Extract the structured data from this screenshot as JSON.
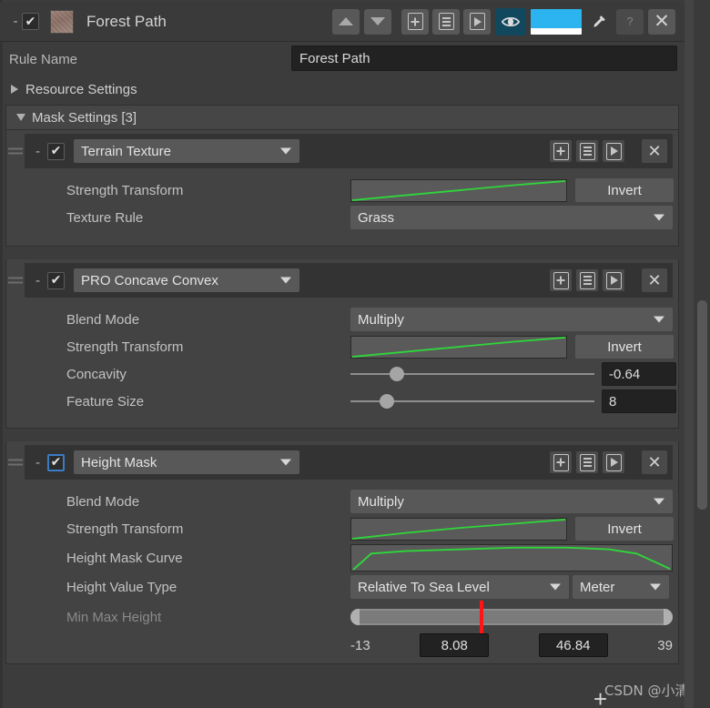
{
  "header": {
    "foldout_dash": "-",
    "enabled": true,
    "check_glyph": "✔",
    "title": "Forest Path",
    "thumbnail_name": "terrain-texture-thumbnail",
    "move_up_icon": "triangle-up-icon",
    "move_down_icon": "triangle-down-icon",
    "add_icon": "add-box-icon",
    "list_icon": "list-box-icon",
    "play_icon": "play-box-icon",
    "visibility_icon": "eye-icon",
    "color_swatch": "#2BB4EF",
    "color_swatch_underline": "#FFFFFF",
    "eyedropper_icon": "eyedropper-icon",
    "help_label": "?",
    "close_label": "✕"
  },
  "rule_name": {
    "label": "Rule Name",
    "value": "Forest Path"
  },
  "resource_settings": {
    "label": "Resource Settings",
    "expanded": false
  },
  "mask_settings": {
    "label": "Mask Settings [3]",
    "expanded": true,
    "count": 3
  },
  "masks": [
    {
      "foldout_dash": "-",
      "enabled": true,
      "check_glyph": "✔",
      "selected": false,
      "type": "Terrain Texture",
      "head_buttons": [
        "add-box-icon",
        "list-box-icon",
        "play-box-icon"
      ],
      "close_label": "✕",
      "rows": [
        {
          "kind": "curve",
          "label": "Strength Transform",
          "button": "Invert",
          "curve": "linear-ramp"
        },
        {
          "kind": "dropdown_wide",
          "label": "Texture Rule",
          "value": "Grass"
        }
      ]
    },
    {
      "foldout_dash": "-",
      "enabled": true,
      "check_glyph": "✔",
      "selected": false,
      "type": "PRO Concave Convex",
      "head_buttons": [
        "add-box-icon",
        "list-box-icon",
        "play-box-icon"
      ],
      "close_label": "✕",
      "rows": [
        {
          "kind": "dropdown_wide",
          "label": "Blend Mode",
          "value": "Multiply"
        },
        {
          "kind": "curve",
          "label": "Strength Transform",
          "button": "Invert",
          "curve": "linear-ramp"
        },
        {
          "kind": "slider",
          "label": "Concavity",
          "value": "-0.64",
          "percent": 19
        },
        {
          "kind": "slider",
          "label": "Feature Size",
          "value": "8",
          "percent": 15
        }
      ]
    },
    {
      "foldout_dash": "-",
      "enabled": true,
      "check_glyph": "✔",
      "selected": true,
      "type": "Height Mask",
      "head_buttons": [
        "add-box-icon",
        "list-box-icon",
        "play-box-icon"
      ],
      "close_label": "✕",
      "rows": [
        {
          "kind": "dropdown_wide",
          "label": "Blend Mode",
          "value": "Multiply"
        },
        {
          "kind": "curve",
          "label": "Strength Transform",
          "button": "Invert",
          "curve": "linear-ramp"
        },
        {
          "kind": "curve_wide",
          "label": "Height Mask Curve",
          "curve": "plateau-falloff"
        },
        {
          "kind": "dropdown_pair",
          "label": "Height Value Type",
          "value": "Relative To Sea Level",
          "unit": "Meter"
        },
        {
          "kind": "minmax",
          "label": "Min Max Height",
          "disabled": true,
          "range_min": "-13",
          "range_max": "39",
          "value_min": "8.08",
          "value_max": "46.84",
          "marker_percent": 40,
          "marker_color": "#FF1515"
        }
      ]
    }
  ],
  "footer": {
    "add_mask_label": "+",
    "watermark": "CSDN @小清兔"
  },
  "colors": {
    "window_bg": "#3C3C3C",
    "card_bg": "#434343",
    "head_bg": "#333333",
    "field_bg": "#222222",
    "dropdown_bg": "#585858",
    "curve_line": "#2FD63A",
    "text": "#C2C2C2",
    "accent_blue": "#3B7CC4"
  }
}
